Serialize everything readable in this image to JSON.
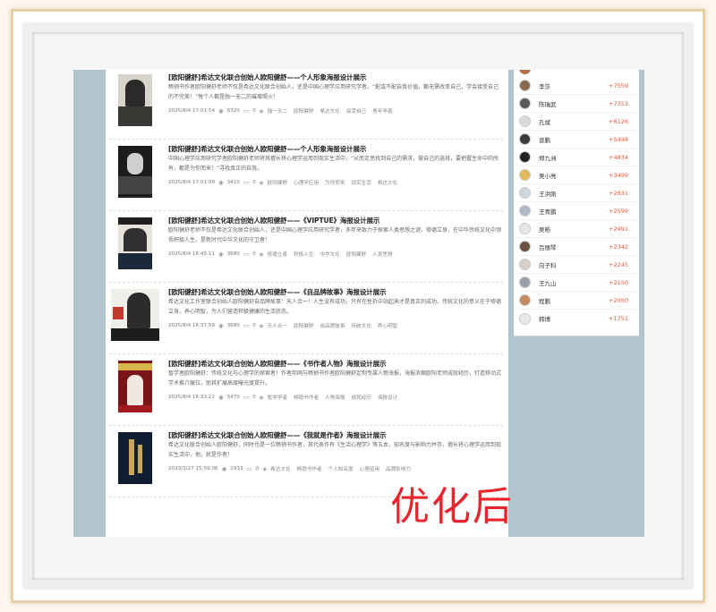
{
  "articles": [
    {
      "title": "[欧阳健舒]希达文化联合创始人欧阳健舒——个人形象海报设计展示",
      "summary": "畅销书作者欧阳健舒老师不仅是希达文化联合创始人，还是中国心理学应用研究学者。“配或不配自我价值，都无需改变自己，学会接受自己的不完美！”每个人都是独一无二的璀璨照火！",
      "date": "2025/8/4 17:01:54",
      "views": "6320",
      "comments": "0",
      "tags": [
        "独一无二",
        "欧阳健舒",
        "希达文化",
        "接受自己",
        "青年学者"
      ]
    },
    {
      "title": "[欧阳健舒]希达文化联合创始人欧阳健舒——个人形象海报设计展示",
      "summary": "中国心理学应用研究学者欧阳健舒老师将其擅长将心理学运用到现实生活中，“从而走思找到自己的需求，做自己的选择，要把握生命中的所有，都是为你而来！”寻找真正的自我。",
      "date": "2025/8/4 17:01:09",
      "views": "3410",
      "comments": "0",
      "tags": [
        "欧阳健舒",
        "心理学应用",
        "为你而来",
        "现实生活",
        "希达文化"
      ]
    },
    {
      "title": "[欧阳健舒]希达文化联合创始人欧阳健舒——《VIPTUE》海报设计展示",
      "summary": "欧阳健舒老师不仅是希达文化联合创始人，还是中国心理学应用研究学者，多年来致力于探索人类思想之谜，修德立身，在中华传统文化中领悟积极人生，是新时代中华文化的守卫者！",
      "date": "2025/8/4 16:45:11",
      "views": "3680",
      "comments": "0",
      "tags": [
        "修德立身",
        "积极人生",
        "中华文化",
        "欧阳健舒",
        "人类思想"
      ]
    },
    {
      "title": "[欧阳健舒]希达文化联合创始人欧阳健舒——《自品牌故事》海报设计展示",
      "summary": "希达文化工作室联合创始人欧阳健舒自品牌故事：天人合一！人生没有成功，只有在挫折中站起来才是真正的成功。传统文化的意义在于修德立身，养心明智，为人们营造积极健康的生活状态。",
      "date": "2025/8/4 16:37:59",
      "views": "3680",
      "comments": "0",
      "tags": [
        "天人合一",
        "欧阳健舒",
        "自品牌故事",
        "传统文化",
        "养心明智"
      ]
    },
    {
      "title": "[欧阳健舒]希达文化联合创始人欧阳健舒——《书作者人物》海报设计展示",
      "summary": "暂学者欧阳健舒：传统文化与心理学的探索者！作者邦网与畅销书作者欧阳健舒定制专属人物海报，海报浓缩欧阳老师成就经历，打造移动式学术推介展位，助其扩展高度曝光度提升。",
      "date": "2025/8/4 16:33:22",
      "views": "5470",
      "comments": "0",
      "tags": [
        "暂学学者",
        "畅销书作者",
        "人物海报",
        "成就经历",
        "海报设计"
      ]
    },
    {
      "title": "[欧阳健舒]希达文化联合创始人欧阳健舒——《我就是作者》海报设计展示",
      "summary": "希达文化联合创始人欧阳健舒，同时也是一位畅销书作者，其代表作有《生活心理学》等五本，知名度与影响力并存，擅长将心理学运用到现实生活中，他，就是作者！",
      "date": "2023/3/27 15:59:06",
      "views": "1933",
      "comments": "0",
      "tags": [
        "希达文化",
        "畅销书作者",
        "个人知名度",
        "心理运用",
        "品牌影响力"
      ]
    }
  ],
  "ranking": [
    {
      "name": "李莎",
      "score": "+7559"
    },
    {
      "name": "陈瑞武",
      "score": "+7313"
    },
    {
      "name": "孔斌",
      "score": "+6126"
    },
    {
      "name": "曾鹏",
      "score": "+5498"
    },
    {
      "name": "郑九洲",
      "score": "+4834"
    },
    {
      "name": "吴小亮",
      "score": "+3499"
    },
    {
      "name": "王洪刚",
      "score": "+2631"
    },
    {
      "name": "王青鹏",
      "score": "+2599"
    },
    {
      "name": "吴皓",
      "score": "+2491"
    },
    {
      "name": "吕丽琴",
      "score": "+2342"
    },
    {
      "name": "向子科",
      "score": "+2245"
    },
    {
      "name": "王九山",
      "score": "+2150"
    },
    {
      "name": "程鹏",
      "score": "+2050"
    },
    {
      "name": "韩博",
      "score": "+1751"
    }
  ],
  "watermark": "优化后",
  "colors": {
    "score": "#e05a3c",
    "page_bg": "#b2c4cc",
    "watermark": "#e8242c"
  }
}
